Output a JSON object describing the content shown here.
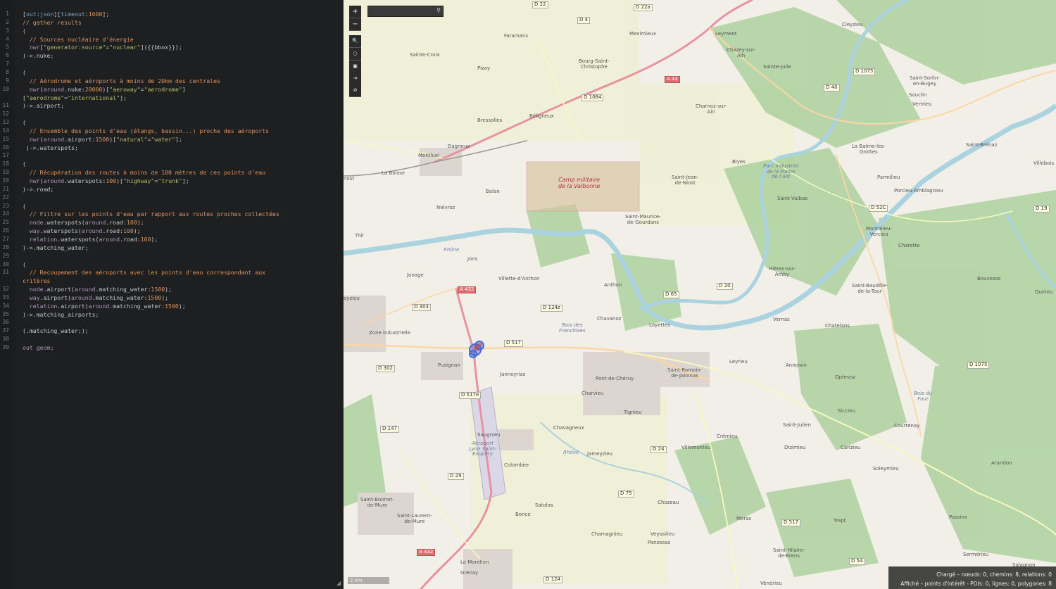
{
  "editor": {
    "lines": [
      {
        "n": "1",
        "parts": [
          [
            "c-plain",
            "["
          ],
          [
            "c-key",
            "out"
          ],
          [
            "c-plain",
            ":"
          ],
          [
            "c-key",
            "json"
          ],
          [
            "c-plain",
            "]["
          ],
          [
            "c-key",
            "timeout"
          ],
          [
            "c-plain",
            ":"
          ],
          [
            "c-num",
            "1600"
          ],
          [
            "c-plain",
            "];"
          ]
        ]
      },
      {
        "n": "2",
        "parts": [
          [
            "c-com",
            "// gather results"
          ]
        ]
      },
      {
        "n": "3",
        "parts": [
          [
            "c-plain",
            "("
          ]
        ]
      },
      {
        "n": "4",
        "parts": [
          [
            "c-com",
            "  // Sources nucléaire d'énergie"
          ]
        ]
      },
      {
        "n": "5",
        "parts": [
          [
            "c-kw",
            "  nwr"
          ],
          [
            "c-plain",
            "["
          ],
          [
            "c-str",
            "\"generator:source\""
          ],
          [
            "c-plain",
            "="
          ],
          [
            "c-str",
            "\"nuclear\""
          ],
          [
            "c-plain",
            "]({{bbox}});"
          ]
        ]
      },
      {
        "n": "6",
        "parts": [
          [
            "c-plain",
            ")->.nuke;"
          ]
        ]
      },
      {
        "n": "7",
        "parts": [
          [
            "c-plain",
            ""
          ]
        ]
      },
      {
        "n": "8",
        "parts": [
          [
            "c-plain",
            "("
          ]
        ]
      },
      {
        "n": "9",
        "parts": [
          [
            "c-com",
            "  // Aérodrome et aéroports à moins de 20km des centrales"
          ]
        ]
      },
      {
        "n": "10",
        "parts": [
          [
            "c-kw",
            "  nwr"
          ],
          [
            "c-plain",
            "("
          ],
          [
            "c-kw",
            "around"
          ],
          [
            "c-plain",
            ".nuke:"
          ],
          [
            "c-num",
            "20000"
          ],
          [
            "c-plain",
            ")["
          ],
          [
            "c-str",
            "\"aeroway\""
          ],
          [
            "c-plain",
            "="
          ],
          [
            "c-str",
            "\"aerodrome\""
          ],
          [
            "c-plain",
            "]"
          ]
        ]
      },
      {
        "n": "",
        "parts": [
          [
            "c-plain",
            "["
          ],
          [
            "c-str",
            "\"aerodrome\""
          ],
          [
            "c-plain",
            "="
          ],
          [
            "c-str",
            "\"international\""
          ],
          [
            "c-plain",
            "];"
          ]
        ]
      },
      {
        "n": "11",
        "parts": [
          [
            "c-plain",
            ")->.airport;"
          ]
        ]
      },
      {
        "n": "12",
        "parts": [
          [
            "c-plain",
            ""
          ]
        ]
      },
      {
        "n": "13",
        "parts": [
          [
            "c-plain",
            "("
          ]
        ]
      },
      {
        "n": "14",
        "parts": [
          [
            "c-com",
            "  // Ensemble des points d'eau (étangs, bassin...) proche des aéroports"
          ]
        ]
      },
      {
        "n": "15",
        "parts": [
          [
            "c-kw",
            "  nwr"
          ],
          [
            "c-plain",
            "("
          ],
          [
            "c-kw",
            "around"
          ],
          [
            "c-plain",
            ".airport:"
          ],
          [
            "c-num",
            "1500"
          ],
          [
            "c-plain",
            ")["
          ],
          [
            "c-str",
            "\"natural\""
          ],
          [
            "c-plain",
            "="
          ],
          [
            "c-str",
            "\"water\""
          ],
          [
            "c-plain",
            "];"
          ]
        ]
      },
      {
        "n": "16",
        "parts": [
          [
            "c-plain",
            " )->.waterspots;"
          ]
        ]
      },
      {
        "n": "17",
        "parts": [
          [
            "c-plain",
            ""
          ]
        ]
      },
      {
        "n": "18",
        "parts": [
          [
            "c-plain",
            "("
          ]
        ]
      },
      {
        "n": "19",
        "parts": [
          [
            "c-com",
            "  // Récupération des routes à moins de 100 mètres de ces points d'eau"
          ]
        ]
      },
      {
        "n": "20",
        "parts": [
          [
            "c-kw",
            "  nwr"
          ],
          [
            "c-plain",
            "("
          ],
          [
            "c-kw",
            "around"
          ],
          [
            "c-plain",
            ".waterspots:"
          ],
          [
            "c-num",
            "100"
          ],
          [
            "c-plain",
            ")["
          ],
          [
            "c-str",
            "\"highway\""
          ],
          [
            "c-plain",
            "="
          ],
          [
            "c-str",
            "\"trunk\""
          ],
          [
            "c-plain",
            "];"
          ]
        ]
      },
      {
        "n": "21",
        "parts": [
          [
            "c-plain",
            ")->.road;"
          ]
        ]
      },
      {
        "n": "22",
        "parts": [
          [
            "c-plain",
            ""
          ]
        ]
      },
      {
        "n": "23",
        "parts": [
          [
            "c-plain",
            "("
          ]
        ]
      },
      {
        "n": "24",
        "parts": [
          [
            "c-com",
            "  // Filtre sur les points d'eau par rapport aux routes proches collectées"
          ]
        ]
      },
      {
        "n": "25",
        "parts": [
          [
            "c-kw",
            "  node"
          ],
          [
            "c-plain",
            ".waterspots("
          ],
          [
            "c-kw",
            "around"
          ],
          [
            "c-plain",
            ".road:"
          ],
          [
            "c-num",
            "100"
          ],
          [
            "c-plain",
            ");"
          ]
        ]
      },
      {
        "n": "26",
        "parts": [
          [
            "c-kw",
            "  way"
          ],
          [
            "c-plain",
            ".waterspots("
          ],
          [
            "c-kw",
            "around"
          ],
          [
            "c-plain",
            ".road:"
          ],
          [
            "c-num",
            "100"
          ],
          [
            "c-plain",
            ");"
          ]
        ]
      },
      {
        "n": "27",
        "parts": [
          [
            "c-kw",
            "  relation"
          ],
          [
            "c-plain",
            ".waterspots("
          ],
          [
            "c-kw",
            "around"
          ],
          [
            "c-plain",
            ".road:"
          ],
          [
            "c-num",
            "100"
          ],
          [
            "c-plain",
            ");"
          ]
        ]
      },
      {
        "n": "28",
        "parts": [
          [
            "c-plain",
            ")->.matching_water;"
          ]
        ]
      },
      {
        "n": "29",
        "parts": [
          [
            "c-plain",
            ""
          ]
        ]
      },
      {
        "n": "30",
        "parts": [
          [
            "c-plain",
            "("
          ]
        ]
      },
      {
        "n": "31",
        "parts": [
          [
            "c-com",
            "  // Recoupement des aéroports avec les points d'eau correspondant aux"
          ]
        ]
      },
      {
        "n": "",
        "parts": [
          [
            "c-com",
            "critères"
          ]
        ]
      },
      {
        "n": "32",
        "parts": [
          [
            "c-kw",
            "  node"
          ],
          [
            "c-plain",
            ".airport("
          ],
          [
            "c-kw",
            "around"
          ],
          [
            "c-plain",
            ".matching_water:"
          ],
          [
            "c-num",
            "1500"
          ],
          [
            "c-plain",
            ");"
          ]
        ]
      },
      {
        "n": "33",
        "parts": [
          [
            "c-kw",
            "  way"
          ],
          [
            "c-plain",
            ".airport("
          ],
          [
            "c-kw",
            "around"
          ],
          [
            "c-plain",
            ".matching_water:"
          ],
          [
            "c-num",
            "1500"
          ],
          [
            "c-plain",
            ");"
          ]
        ]
      },
      {
        "n": "34",
        "parts": [
          [
            "c-kw",
            "  relation"
          ],
          [
            "c-plain",
            ".airport("
          ],
          [
            "c-kw",
            "around"
          ],
          [
            "c-plain",
            ".matching_water:"
          ],
          [
            "c-num",
            "1500"
          ],
          [
            "c-plain",
            ");"
          ]
        ]
      },
      {
        "n": "35",
        "parts": [
          [
            "c-plain",
            ")->.matching_airports;"
          ]
        ]
      },
      {
        "n": "36",
        "parts": [
          [
            "c-plain",
            ""
          ]
        ]
      },
      {
        "n": "37",
        "parts": [
          [
            "c-plain",
            "(.matching_water;);"
          ]
        ]
      },
      {
        "n": "38",
        "parts": [
          [
            "c-plain",
            ""
          ]
        ]
      },
      {
        "n": "39",
        "parts": [
          [
            "c-kw",
            "out"
          ],
          [
            "c-plain",
            " "
          ],
          [
            "c-kw",
            "geom"
          ],
          [
            "c-plain",
            ";"
          ]
        ]
      }
    ]
  },
  "map": {
    "zoom_in": "+",
    "zoom_out": "−",
    "search_placeholder": "",
    "scale": "2 km",
    "stats_loaded": "Chargé – nœuds: 0, chemins: 8, relations: 0",
    "stats_shown": "Affiché – points d'intérêt - POIs: 0, lignes: 0, polygones: 8",
    "places": [
      {
        "t": "D 22",
        "k": "road y"
      },
      {
        "t": "D 22a",
        "k": "road y"
      },
      {
        "t": "D 4",
        "k": "road y"
      },
      {
        "t": "Faramans",
        "k": ""
      },
      {
        "t": "Meximieux",
        "k": ""
      },
      {
        "t": "Leyment",
        "k": ""
      },
      {
        "t": "Cleyzieu",
        "k": ""
      },
      {
        "t": "Sainte-Croix",
        "k": ""
      },
      {
        "t": "Bourg-Saint-\nChristophe",
        "k": ""
      },
      {
        "t": "Chazey-sur-\nAin",
        "k": ""
      },
      {
        "t": "Sainte-Julie",
        "k": ""
      },
      {
        "t": "D 1075",
        "k": "road y"
      },
      {
        "t": "Saint-Sorlin-\nen-Bugey",
        "k": ""
      },
      {
        "t": "Pizay",
        "k": ""
      },
      {
        "t": "A 42",
        "k": "road m"
      },
      {
        "t": "D 40",
        "k": "road y"
      },
      {
        "t": "Souclin",
        "k": ""
      },
      {
        "t": "D 1084",
        "k": "road y"
      },
      {
        "t": "Charnoz-sur-\nAin",
        "k": ""
      },
      {
        "t": "Vertrieu",
        "k": ""
      },
      {
        "t": "Béligneux",
        "k": ""
      },
      {
        "t": "Bressolles",
        "k": ""
      },
      {
        "t": "Dagneux",
        "k": ""
      },
      {
        "t": "Montluel",
        "k": ""
      },
      {
        "t": "La Balme-les-\nGrottes",
        "k": ""
      },
      {
        "t": "Saint-Baudille-\nde-la-Tour",
        "k": ""
      },
      {
        "t": "Saint-Brénaz",
        "k": ""
      },
      {
        "t": "La Boisse",
        "k": ""
      },
      {
        "t": "Blyes",
        "k": ""
      },
      {
        "t": "Parc industriel\nde la Plaine\nde l'Ain",
        "k": "park"
      },
      {
        "t": "Villebois",
        "k": ""
      },
      {
        "t": "Camp militaire\nde la Valbonne",
        "k": "mil"
      },
      {
        "t": "Saint-Jean-\nde-Niost",
        "k": ""
      },
      {
        "t": "Parmilieu",
        "k": ""
      },
      {
        "t": "Balan",
        "k": ""
      },
      {
        "t": "Porcieu-Amblagnieu",
        "k": ""
      },
      {
        "t": "Saint-Vulbas",
        "k": ""
      },
      {
        "t": "D 52C",
        "k": "road y"
      },
      {
        "t": "D 19",
        "k": "road y"
      },
      {
        "t": "Niévroz",
        "k": ""
      },
      {
        "t": "Saint-Maurice-\nde-Gourdans",
        "k": ""
      },
      {
        "t": "Montalieu-\nVercieu",
        "k": ""
      },
      {
        "t": "Thil",
        "k": ""
      },
      {
        "t": "Charette",
        "k": ""
      },
      {
        "t": "Jons",
        "k": ""
      },
      {
        "t": "Hières-sur-\nAmby",
        "k": ""
      },
      {
        "t": "Jonage",
        "k": ""
      },
      {
        "t": "Villette-d'Anthon",
        "k": ""
      },
      {
        "t": "Bouvesse",
        "k": ""
      },
      {
        "t": "A 432",
        "k": "road m"
      },
      {
        "t": "Anthon",
        "k": ""
      },
      {
        "t": "D 20",
        "k": "road y"
      },
      {
        "t": "Quirieu",
        "k": ""
      },
      {
        "t": "D 303",
        "k": "road y"
      },
      {
        "t": "D 124z",
        "k": "road y"
      },
      {
        "t": "D 65",
        "k": "road y"
      },
      {
        "t": "Chavanoz",
        "k": ""
      },
      {
        "t": "Vernas",
        "k": ""
      },
      {
        "t": "Chatelans",
        "k": ""
      },
      {
        "t": "Loyettes",
        "k": ""
      },
      {
        "t": "D 517",
        "k": "road y"
      },
      {
        "t": "Zone industrielle",
        "k": ""
      },
      {
        "t": "Bois des\nFranchises",
        "k": "park"
      },
      {
        "t": "Leyrieu",
        "k": ""
      },
      {
        "t": "Annoisin",
        "k": ""
      },
      {
        "t": "D 302",
        "k": "road y"
      },
      {
        "t": "Pusignan",
        "k": ""
      },
      {
        "t": "Janneyrias",
        "k": ""
      },
      {
        "t": "Saint-Romain-\nde-Jalionas",
        "k": ""
      },
      {
        "t": "D 1075",
        "k": "road y"
      },
      {
        "t": "Pont-de-Chéruy",
        "k": ""
      },
      {
        "t": "Optevoz",
        "k": ""
      },
      {
        "t": "Charvieu",
        "k": ""
      },
      {
        "t": "D 517e",
        "k": "road y"
      },
      {
        "t": "Tignieu",
        "k": ""
      },
      {
        "t": "Bois du\nFour",
        "k": "park"
      },
      {
        "t": "Siccieu",
        "k": ""
      },
      {
        "t": "D 147",
        "k": "road y"
      },
      {
        "t": "Chavagneux",
        "k": ""
      },
      {
        "t": "Saint-Julien",
        "k": ""
      },
      {
        "t": "Courtenay",
        "k": ""
      },
      {
        "t": "Crémieu",
        "k": ""
      },
      {
        "t": "Saugnieu",
        "k": ""
      },
      {
        "t": "Villemoirieu",
        "k": ""
      },
      {
        "t": "Dizimieu",
        "k": ""
      },
      {
        "t": "Carizieu",
        "k": ""
      },
      {
        "t": "Aéroport\nLyon Saint-\nExupéry",
        "k": "park"
      },
      {
        "t": "D 24",
        "k": "road y"
      },
      {
        "t": "Jameyzieu",
        "k": ""
      },
      {
        "t": "Colombier",
        "k": ""
      },
      {
        "t": "Soleymieu",
        "k": ""
      },
      {
        "t": "Arandon",
        "k": ""
      },
      {
        "t": "D 29",
        "k": "road y"
      },
      {
        "t": "D 75",
        "k": "road y"
      },
      {
        "t": "Saint-Bonnet-\nde-Mure",
        "k": ""
      },
      {
        "t": "Satolas",
        "k": ""
      },
      {
        "t": "Chozeau",
        "k": ""
      },
      {
        "t": "Saint-Laurent-\nde-Mure",
        "k": ""
      },
      {
        "t": "Bonce",
        "k": ""
      },
      {
        "t": "Moras",
        "k": ""
      },
      {
        "t": "D 517",
        "k": "road y"
      },
      {
        "t": "Trept",
        "k": ""
      },
      {
        "t": "Passins",
        "k": ""
      },
      {
        "t": "Chamagnieu",
        "k": ""
      },
      {
        "t": "Veyssilieu",
        "k": ""
      },
      {
        "t": "Panossas",
        "k": ""
      },
      {
        "t": "Saint-Hilaire-\nde-Brens",
        "k": ""
      },
      {
        "t": "Sermérieu",
        "k": ""
      },
      {
        "t": "A 432",
        "k": "road m"
      },
      {
        "t": "D 54",
        "k": "road y"
      },
      {
        "t": "Le Morellon",
        "k": ""
      },
      {
        "t": "Grenay",
        "k": ""
      },
      {
        "t": "D 124",
        "k": "road y"
      },
      {
        "t": "Salagnon",
        "k": ""
      },
      {
        "t": "Vénérieu",
        "k": ""
      },
      {
        "t": "eyzieu",
        "k": ""
      },
      {
        "t": "nost",
        "k": ""
      },
      {
        "t": "Rhône",
        "k": "river"
      },
      {
        "t": "Rhône",
        "k": "river"
      }
    ]
  }
}
